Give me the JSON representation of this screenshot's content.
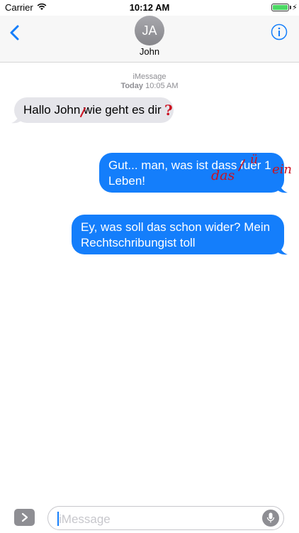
{
  "status_bar": {
    "carrier": "Carrier",
    "time": "10:12 AM",
    "battery_level": 1.0,
    "charging_symbol": "⚡"
  },
  "header": {
    "back_icon": "chevron-left-icon",
    "avatar_initials": "JA",
    "contact_name": "John",
    "info_icon": "info-icon"
  },
  "conversation": {
    "service_label": "iMessage",
    "timestamp_day": "Today",
    "timestamp_time": "10:05 AM",
    "messages": [
      {
        "direction": "incoming",
        "text": "Hallo John wie geht es dir"
      },
      {
        "direction": "outgoing",
        "line1": "Gut... man, was ist dass fuer 1",
        "line2": "Leben!"
      },
      {
        "direction": "outgoing",
        "line1": "Ey, was soll das schon wider? Mein",
        "line2": "Rechtschribungist toll"
      }
    ],
    "corrections": [
      "?",
      "das",
      "ü",
      "ein"
    ]
  },
  "input_bar": {
    "placeholder": "iMessage",
    "expand_icon": "chevron-right-icon",
    "mic_icon": "microphone-icon"
  },
  "colors": {
    "accent": "#147efb",
    "incoming_bubble": "#e5e5ea",
    "correction_red": "#cc1020"
  }
}
